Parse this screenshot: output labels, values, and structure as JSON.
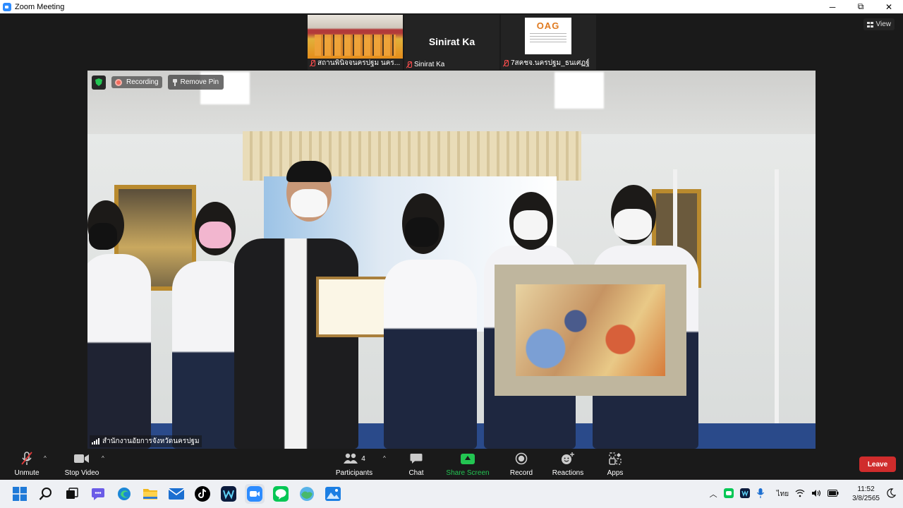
{
  "window": {
    "title": "Zoom Meeting",
    "minimize": "─",
    "maximize": "⧉",
    "close": "✕"
  },
  "view_button": {
    "label": "View",
    "icon": "grid-icon"
  },
  "thumbnails": [
    {
      "name": "สถานพินิจจนครปฐม นคร...",
      "muted": true,
      "type": "video"
    },
    {
      "name": "Sinirat Ka",
      "muted": true,
      "type": "name",
      "display": "Sinirat Ka"
    },
    {
      "name": "7สคชจ.นครปฐม_ธนเศฏฐ์",
      "muted": true,
      "type": "logo",
      "logo_text": "OAG"
    }
  ],
  "main_video": {
    "recording_label": "Recording",
    "remove_pin_label": "Remove Pin",
    "speaker_name": "สำนักงานอัยการจังหวัดนครปฐม"
  },
  "toolbar": {
    "unmute": "Unmute",
    "stop_video": "Stop Video",
    "participants": "Participants",
    "participants_count": "4",
    "chat": "Chat",
    "share_screen": "Share Screen",
    "record": "Record",
    "reactions": "Reactions",
    "apps": "Apps",
    "leave": "Leave",
    "share_color": "#23c552",
    "leave_color": "#d02c2c"
  },
  "taskbar": {
    "apps": [
      "windows-start-icon",
      "search-icon",
      "task-view-icon",
      "chat-icon",
      "edge-icon",
      "file-explorer-icon",
      "mail-icon",
      "tiktok-icon",
      "webex-icon",
      "zoom-icon",
      "line-icon",
      "weather-icon",
      "photos-icon"
    ],
    "language": "ไทย",
    "time": "11:52",
    "date": "3/8/2565"
  }
}
